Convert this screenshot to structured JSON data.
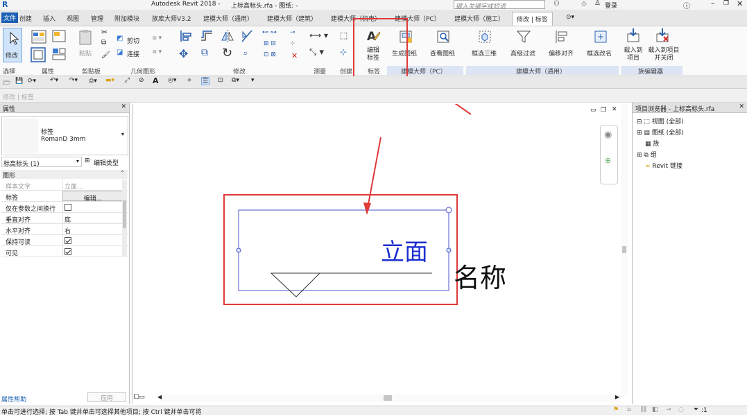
{
  "app": {
    "title": "Autodesk Revit 2018 -",
    "document": "上标高标头.rfa - 图纸: -",
    "search_placeholder": "键入关键字或短语",
    "login": "登录"
  },
  "tabs": [
    {
      "label": "文件"
    },
    {
      "label": "创建"
    },
    {
      "label": "插入"
    },
    {
      "label": "视图"
    },
    {
      "label": "管理"
    },
    {
      "label": "附加模块"
    },
    {
      "label": "族库大师V3.2"
    },
    {
      "label": "建模大师（通用）"
    },
    {
      "label": "建模大师（建筑）"
    },
    {
      "label": "建模大师（机电）"
    },
    {
      "label": "建模大师（PC）"
    },
    {
      "label": "建模大师（施工）"
    },
    {
      "label": "修改 | 标签"
    }
  ],
  "ribbon": {
    "select_panel": "选择",
    "modify": "修改",
    "props_panel": "属性",
    "clipboard_panel": "剪贴板",
    "paste": "粘贴",
    "cut": "剪切",
    "join": "连接",
    "geometry_panel": "几何图形",
    "modify_panel": "修改",
    "measure_panel": "测量",
    "create_panel": "创建",
    "edit_label": "编辑标签",
    "label_panel": "标签",
    "gen_sheet": "生成图纸",
    "view_sheet": "查看图纸",
    "pc_panel": "建模大师（PC）",
    "box_3d": "框选三维",
    "adv_filter": "高级过滤",
    "offset_align": "偏移对齐",
    "box_rename": "框选改名",
    "general_panel": "建模大师（通用）",
    "load_to_project": "载入到项目",
    "load_close": "载入到项目并关闭",
    "family_editor_panel": "族编辑器"
  },
  "optbar": {
    "text": "修改 | 标签"
  },
  "properties": {
    "title": "属性",
    "type_name": "标签",
    "type_sub": "RomanD 3mm",
    "selector": "标高标头 (1)",
    "edit_type": "编辑类型",
    "group": "图形",
    "rows": [
      {
        "key": "样本文字",
        "value": "立面..."
      },
      {
        "key": "标签",
        "value": "编辑..."
      },
      {
        "key": "仅在参数之间换行",
        "value": ""
      },
      {
        "key": "垂直对齐",
        "value": "底"
      },
      {
        "key": "水平对齐",
        "value": "右"
      },
      {
        "key": "保持可读",
        "value": ""
      },
      {
        "key": "可见",
        "value": ""
      }
    ],
    "checks": {
      "wrap": false,
      "readable": true,
      "visible": true
    },
    "help": "属性帮助",
    "apply": "应用"
  },
  "canvas": {
    "label_text": "立面",
    "name_text": "名称"
  },
  "browser": {
    "title": "项目浏览器 - 上标高标头.rfa",
    "items": [
      {
        "label": "视图 (全部)"
      },
      {
        "label": "图纸 (全部)"
      },
      {
        "label": "族"
      },
      {
        "label": "组"
      },
      {
        "label": "Revit 链接"
      }
    ]
  },
  "status": {
    "text": "单击可进行选择; 按 Tab 键并单击可选择其他项目; 按 Ctrl 键并单击可将",
    "filter_count": ":1"
  },
  "colors": {
    "highlight": "#e0393a",
    "label_blue": "#1d2fcf",
    "tab_active_bg": "#ffffff"
  }
}
